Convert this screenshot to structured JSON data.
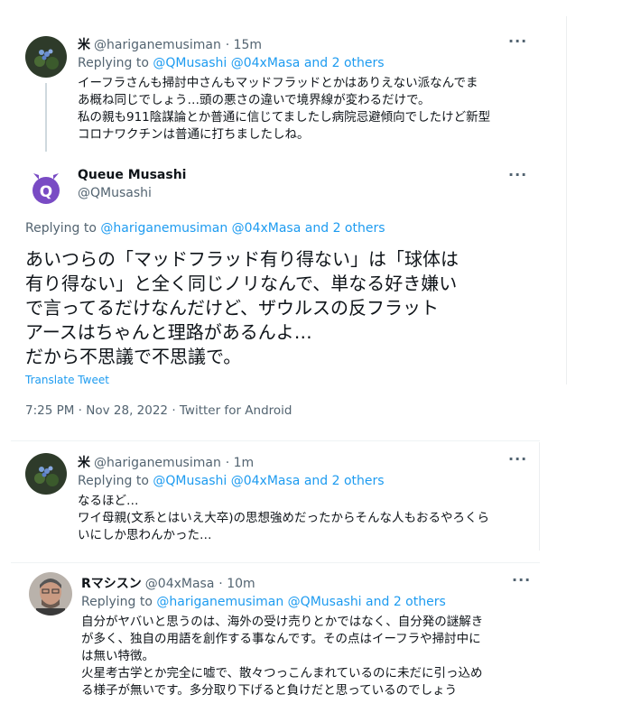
{
  "tweets": [
    {
      "display_name": "米",
      "handle": "@hariganemusiman",
      "time": "· 15m",
      "reply_prefix": "Replying to",
      "mentions": "@QMusashi @04xMasa",
      "and": "and",
      "others": "2 others",
      "lines": [
        "イーフラさんも掃討中さんもマッドフラッドとかはありえない派なんでま",
        "あ概ね同じでしょう…頭の悪さの違いで境界線が変わるだけで。",
        "私の親も911陰謀論とか普通に信じてましたし病院忌避傾向でしたけど新型",
        "コロナワクチンは普通に打ちましたしね。"
      ]
    },
    {
      "display_name": "Queue Musashi",
      "handle": "@QMusashi",
      "reply_prefix": "Replying to",
      "mentions": "@hariganemusiman @04xMasa",
      "and": "and",
      "others": "2 others",
      "lines": [
        "あいつらの「マッドフラッド有り得ない」は「球体は",
        "有り得ない」と全く同じノリなんで、単なる好き嫌い",
        "で言ってるだけなんだけど、ザウルスの反フラット",
        "アースはちゃんと理路があるんよ…",
        "だから不思議で不思議で。"
      ],
      "translate": "Translate Tweet",
      "timestamp": "7:25 PM · Nov 28, 2022 · Twitter for Android"
    },
    {
      "display_name": "米",
      "handle": "@hariganemusiman",
      "time": "· 1m",
      "reply_prefix": "Replying to",
      "mentions": "@QMusashi @04xMasa",
      "and": "and",
      "others": "2 others",
      "lines": [
        "なるほど…",
        "ワイ母親(文系とはいえ大卒)の思想強めだったからそんな人もおるやろくら",
        "いにしか思わんかった…"
      ]
    },
    {
      "display_name": "Rマシスン",
      "handle": "@04xMasa",
      "time": "· 10m",
      "reply_prefix": "Replying to",
      "mentions": "@hariganemusiman @QMusashi",
      "and": "and",
      "others": "2 others",
      "lines": [
        "自分がヤバいと思うのは、海外の受け売りとかではなく、自分発の謎解き",
        "が多く、独自の用語を創作する事なんです。その点はイーフラや掃討中に",
        "は無い特徴。",
        "火星考古学とか完全に嘘で、散々つっこんまれているのに未だに引っ込め",
        "る様子が無いです。多分取り下げると負けだと思っているのでしょう"
      ]
    }
  ],
  "icons": {
    "more": "more-icon",
    "avatar_q": "Q"
  },
  "colors": {
    "accent": "#1d9bf0",
    "muted": "#536471",
    "purple": "#794bc4"
  }
}
